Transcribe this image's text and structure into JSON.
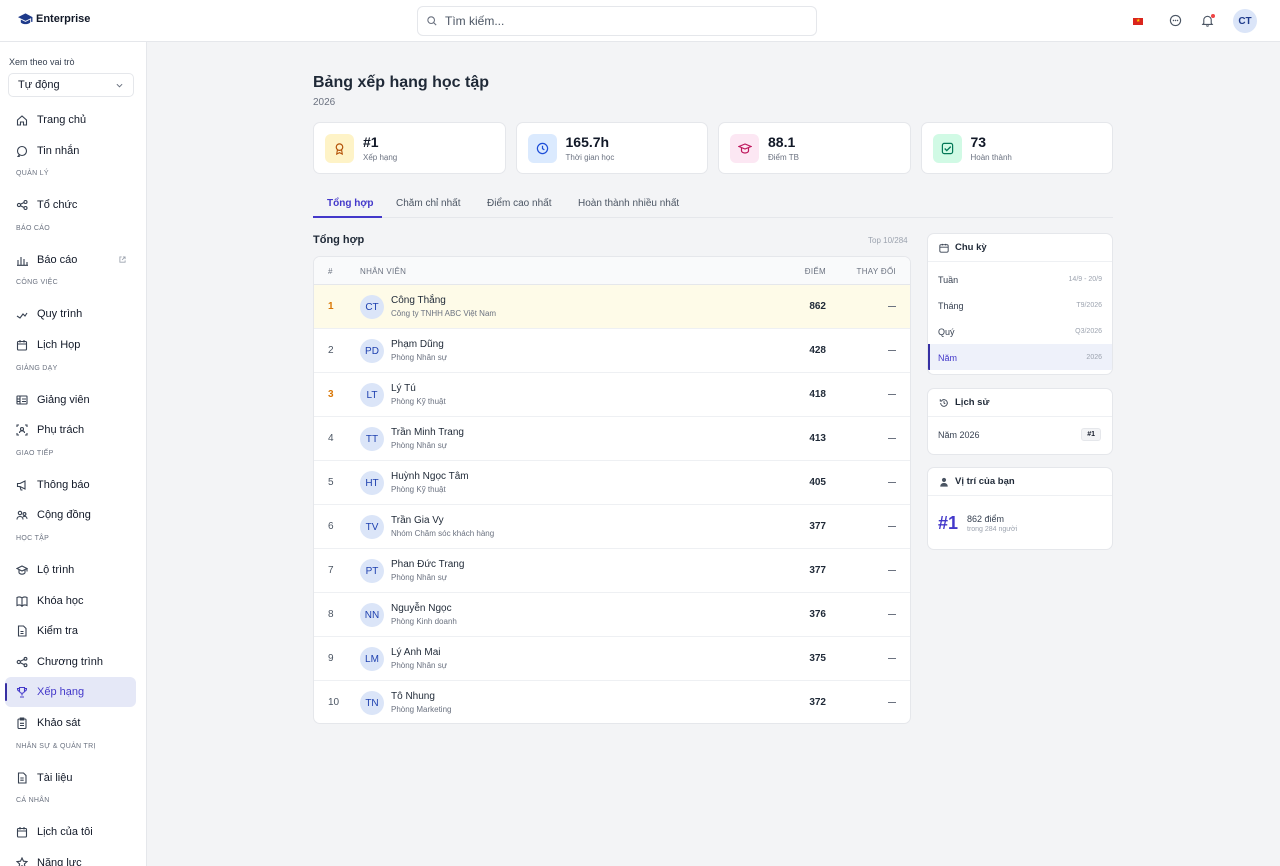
{
  "app": {
    "name": "Enterprise",
    "avatar_initials": "CT"
  },
  "search": {
    "placeholder": "Tìm kiếm..."
  },
  "sidebar": {
    "role_label": "Xem theo vai trò",
    "role_value": "Tự động",
    "items": [
      {
        "label": "Trang chủ",
        "icon": "home-icon"
      },
      {
        "label": "Tin nhắn",
        "icon": "message-icon"
      },
      {
        "section": "QUẢN LÝ"
      },
      {
        "label": "Tổ chức",
        "icon": "org-icon"
      },
      {
        "section": "BÁO CÁO"
      },
      {
        "label": "Báo cáo",
        "icon": "chart-icon",
        "external": true
      },
      {
        "section": "CÔNG VIỆC"
      },
      {
        "label": "Quy trình",
        "icon": "workflow-icon"
      },
      {
        "label": "Lịch Họp",
        "icon": "calendar-icon"
      },
      {
        "section": "GIẢNG DẠY"
      },
      {
        "label": "Giảng viên",
        "icon": "board-icon"
      },
      {
        "label": "Phụ trách",
        "icon": "assign-icon"
      },
      {
        "section": "GIAO TIẾP"
      },
      {
        "label": "Thông báo",
        "icon": "megaphone-icon"
      },
      {
        "label": "Cộng đồng",
        "icon": "community-icon"
      },
      {
        "section": "HỌC TẬP"
      },
      {
        "label": "Lộ trình",
        "icon": "graduation-icon"
      },
      {
        "label": "Khóa học",
        "icon": "book-icon"
      },
      {
        "label": "Kiểm tra",
        "icon": "test-icon"
      },
      {
        "label": "Chương trình",
        "icon": "program-icon"
      },
      {
        "label": "Xếp hạng",
        "icon": "trophy-icon",
        "active": true
      },
      {
        "label": "Khảo sát",
        "icon": "clipboard-icon"
      },
      {
        "section": "NHÂN SỰ & QUẢN TRỊ"
      },
      {
        "label": "Tài liệu",
        "icon": "document-icon"
      },
      {
        "section": "CÁ NHÂN"
      },
      {
        "label": "Lịch của tôi",
        "icon": "calendar-icon"
      },
      {
        "label": "Năng lực",
        "icon": "star-icon"
      }
    ]
  },
  "page": {
    "title": "Bảng xếp hạng học tập",
    "subtitle": "2026"
  },
  "stats": [
    {
      "value": "#1",
      "label": "Xếp hạng",
      "icon": "medal-icon",
      "bg": "#fef3c7",
      "fg": "#b45309"
    },
    {
      "value": "165.7h",
      "label": "Thời gian học",
      "icon": "clock-icon",
      "bg": "#dbeafe",
      "fg": "#1d4ed8"
    },
    {
      "value": "88.1",
      "label": "Điểm TB",
      "icon": "cap-icon",
      "bg": "#fce7f3",
      "fg": "#be185d"
    },
    {
      "value": "73",
      "label": "Hoàn thành",
      "icon": "check-icon",
      "bg": "#d1fae5",
      "fg": "#047857"
    }
  ],
  "tabs": [
    "Tổng hợp",
    "Chăm chỉ nhất",
    "Điểm cao nhất",
    "Hoàn thành nhiều nhất"
  ],
  "leaderboard": {
    "title": "Tổng hợp",
    "meta": "Top 10/284",
    "columns": {
      "rank": "#",
      "employee": "NHÂN VIÊN",
      "score": "ĐIỂM",
      "change": "THAY ĐỔI"
    },
    "rows": [
      {
        "rank": "1",
        "initials": "CT",
        "name": "Công Thắng",
        "org": "Công ty TNHH ABC Việt Nam",
        "score": "862"
      },
      {
        "rank": "2",
        "initials": "PD",
        "name": "Phạm Dũng",
        "org": "Phòng Nhân sự",
        "score": "428"
      },
      {
        "rank": "3",
        "initials": "LT",
        "name": "Lý Tú",
        "org": "Phòng Kỹ thuật",
        "score": "418"
      },
      {
        "rank": "4",
        "initials": "TT",
        "name": "Trần Minh Trang",
        "org": "Phòng Nhân sự",
        "score": "413"
      },
      {
        "rank": "5",
        "initials": "HT",
        "name": "Huỳnh Ngọc Tâm",
        "org": "Phòng Kỹ thuật",
        "score": "405"
      },
      {
        "rank": "6",
        "initials": "TV",
        "name": "Trần Gia Vy",
        "org": "Nhóm Chăm sóc khách hàng",
        "score": "377"
      },
      {
        "rank": "7",
        "initials": "PT",
        "name": "Phan Đức Trang",
        "org": "Phòng Nhân sự",
        "score": "377"
      },
      {
        "rank": "8",
        "initials": "NN",
        "name": "Nguyễn Ngọc",
        "org": "Phòng Kinh doanh",
        "score": "376"
      },
      {
        "rank": "9",
        "initials": "LM",
        "name": "Lý Anh Mai",
        "org": "Phòng Nhân sự",
        "score": "375"
      },
      {
        "rank": "10",
        "initials": "TN",
        "name": "Tô Nhung",
        "org": "Phòng Marketing",
        "score": "372"
      }
    ]
  },
  "cycle": {
    "title": "Chu kỳ",
    "options": [
      {
        "label": "Tuần",
        "range": "14/9 - 20/9"
      },
      {
        "label": "Tháng",
        "range": "T9/2026"
      },
      {
        "label": "Quý",
        "range": "Q3/2026"
      },
      {
        "label": "Năm",
        "range": "2026",
        "active": true
      }
    ]
  },
  "history": {
    "title": "Lịch sử",
    "entries": [
      {
        "label": "Năm 2026",
        "badge": "#1"
      }
    ]
  },
  "position": {
    "title": "Vị trí của bạn",
    "rank": "#1",
    "points": "862 điểm",
    "of": "trong 284 người"
  },
  "colors": {
    "accent": "#4338ca",
    "gold": "#d97706",
    "highlight_row": "#fefbe8"
  }
}
